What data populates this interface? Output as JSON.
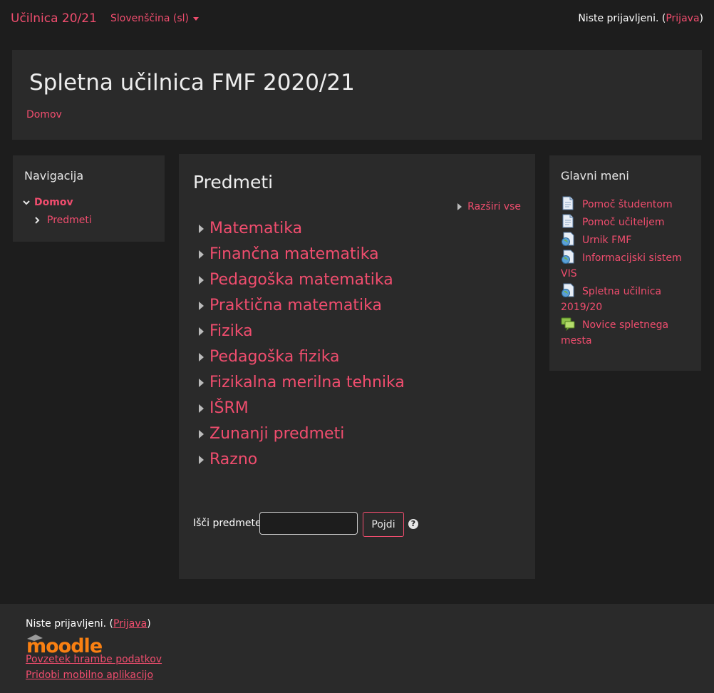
{
  "navbar": {
    "brand": "Učilnica 20/21",
    "language": "Slovenščina (sl)",
    "login_text": "Niste prijavljeni. (",
    "login_link": "Prijava",
    "login_close": ")"
  },
  "header": {
    "title": "Spletna učilnica FMF 2020/21",
    "breadcrumb": "Domov"
  },
  "navigation": {
    "title": "Navigacija",
    "root": "Domov",
    "child": "Predmeti"
  },
  "main": {
    "title": "Predmeti",
    "expand_all": "Razširi vse",
    "categories": [
      "Matematika",
      "Finančna matematika",
      "Pedagoška matematika",
      "Praktična matematika",
      "Fizika",
      "Pedagoška fizika",
      "Fizikalna merilna tehnika",
      "IŠRM",
      "Zunanji predmeti",
      "Razno"
    ],
    "search_label": "Išči predmete",
    "search_value": "",
    "search_button": "Pojdi",
    "help_glyph": "?"
  },
  "main_menu": {
    "title": "Glavni meni",
    "items": [
      {
        "label": "Pomoč študentom",
        "icon": "document-icon"
      },
      {
        "label": "Pomoč učiteljem",
        "icon": "document-icon"
      },
      {
        "label": "Urnik FMF",
        "icon": "url-globe-icon"
      },
      {
        "label": "Informacijski sistem VIS",
        "icon": "url-globe-icon"
      },
      {
        "label": "Spletna učilnica 2019/20",
        "icon": "url-globe-icon"
      },
      {
        "label": "Novice spletnega mesta",
        "icon": "forum-icon"
      }
    ]
  },
  "footer": {
    "login_text": "Niste prijavljeni. (",
    "login_link": "Prijava",
    "login_close": ")",
    "logo_text": "moodle",
    "data_retention": "Povzetek hrambe podatkov",
    "mobile_app": "Pridobi mobilno aplikacijo"
  },
  "colors": {
    "accent": "#f04d6e",
    "background": "#1d1d1d",
    "panel": "#2a2a2a",
    "moodle_orange": "#f98012"
  }
}
